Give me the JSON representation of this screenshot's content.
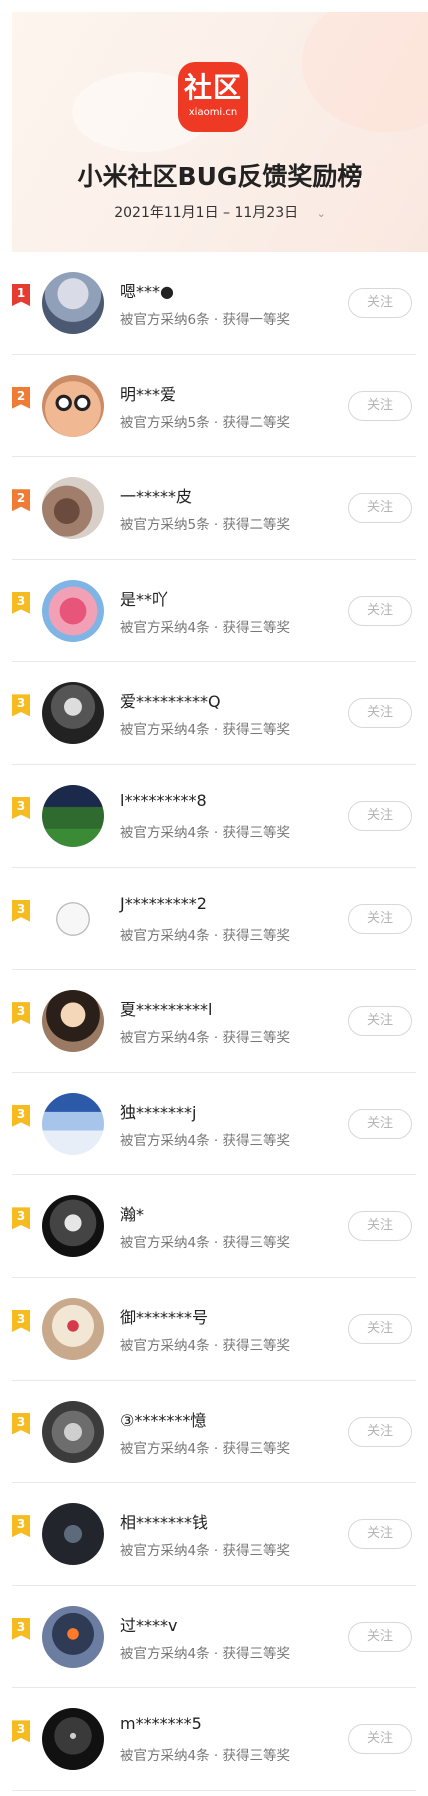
{
  "header": {
    "logo_text": "社区",
    "logo_sub": "xiaomi.cn",
    "title": "小米社区BUG反馈奖励榜",
    "date_range": "2021年11月1日 – 11月23日",
    "date_chevron": "⌄",
    "colors": {
      "brand": "#ee3a25"
    }
  },
  "follow_label": "关注",
  "ranks": {
    "colors": {
      "1": "#e53b30",
      "2": "#f07b34",
      "3": "#f5bb1f"
    }
  },
  "entries": [
    {
      "rank": "1",
      "name": "嗯***●",
      "desc": "被官方采纳6条 · 获得一等奖",
      "avatar": "anime-girl-avatar"
    },
    {
      "rank": "2",
      "name": "明***爱",
      "desc": "被官方采纳5条 · 获得二等奖",
      "avatar": "glasses-face-avatar"
    },
    {
      "rank": "2",
      "name": "一*****皮",
      "desc": "被官方采纳5条 · 获得二等奖",
      "avatar": "photo-avatar"
    },
    {
      "rank": "3",
      "name": "是**吖",
      "desc": "被官方采纳4条 · 获得三等奖",
      "avatar": "cartoon-star-avatar"
    },
    {
      "rank": "3",
      "name": "爱*********Q",
      "desc": "被官方采纳4条 · 获得三等奖",
      "avatar": "anime-boy-avatar"
    },
    {
      "rank": "3",
      "name": "l*********8",
      "desc": "被官方采纳4条 · 获得三等奖",
      "avatar": "landscape-avatar"
    },
    {
      "rank": "3",
      "name": "J*********2",
      "desc": "被官方采纳4条 · 获得三等奖",
      "avatar": "sketch-avatar"
    },
    {
      "rank": "3",
      "name": "夏*********l",
      "desc": "被官方采纳4条 · 获得三等奖",
      "avatar": "girl-photo-avatar"
    },
    {
      "rank": "3",
      "name": "独*******j",
      "desc": "被官方采纳4条 · 获得三等奖",
      "avatar": "sky-avatar"
    },
    {
      "rank": "3",
      "name": "瀚*",
      "desc": "被官方采纳4条 · 获得三等奖",
      "avatar": "joker-avatar"
    },
    {
      "rank": "3",
      "name": "御*******号",
      "desc": "被官方采纳4条 · 获得三等奖",
      "avatar": "anime-white-hair-avatar"
    },
    {
      "rank": "3",
      "name": "③*******憶",
      "desc": "被官方采纳4条 · 获得三等奖",
      "avatar": "cat-avatar"
    },
    {
      "rank": "3",
      "name": "相*******钱",
      "desc": "被官方采纳4条 · 获得三等奖",
      "avatar": "dark-sign-avatar"
    },
    {
      "rank": "3",
      "name": "过****v",
      "desc": "被官方采纳4条 · 获得三等奖",
      "avatar": "soldier-avatar"
    },
    {
      "rank": "3",
      "name": "m*******5",
      "desc": "被官方采纳4条 · 获得三等奖",
      "avatar": "moon-avatar"
    }
  ]
}
